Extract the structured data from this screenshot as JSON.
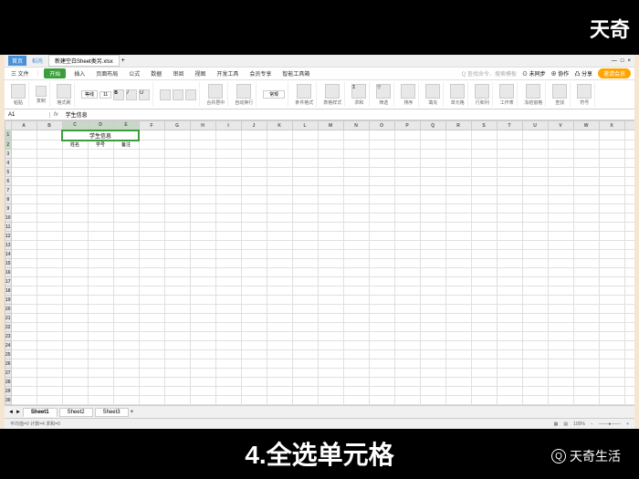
{
  "watermark_tr": "天奇",
  "watermark_br": "天奇生活",
  "watermark_q": "Q",
  "caption": "4.全选单元格",
  "titlebar": {
    "home": "首页",
    "browser_tab": "稻壳",
    "doc_tab": "新建空白Sheet类另.xlsx",
    "plus": "+",
    "min": "—",
    "max": "□",
    "close": "×"
  },
  "menu": {
    "file": "三 文件",
    "items": [
      "开始",
      "插入",
      "页面布局",
      "公式",
      "数据",
      "审阅",
      "视图",
      "开发工具",
      "会员专享",
      "智能工具箱"
    ],
    "search": "Q 查找命令、搜索模板",
    "unsync": "⊙ 未同步",
    "coop": "⊕ 协作",
    "share": "凸 分享",
    "member": "邀请会员"
  },
  "ribbon": {
    "paste": "粘贴",
    "cut": "剪切",
    "copy": "复制",
    "format_paint": "格式刷",
    "font": "等线",
    "font_size": "11",
    "merge": "合并居中",
    "wrap": "自动换行",
    "format": "常规",
    "conditional": "条件格式",
    "cell_style": "表格样式",
    "sum": "求和",
    "filter": "筛选",
    "sort": "排序",
    "fill": "填充",
    "cell": "单元格",
    "row_col": "行和列",
    "worksheet": "工作表",
    "freeze": "冻结窗格",
    "find": "查找",
    "symbol": "符号"
  },
  "name_box": "A1",
  "fx": "fx",
  "formula_value": "学生信息",
  "cols": [
    "A",
    "B",
    "C",
    "D",
    "E",
    "F",
    "G",
    "H",
    "I",
    "J",
    "K",
    "L",
    "M",
    "N",
    "O",
    "P",
    "Q",
    "R",
    "S",
    "T",
    "U",
    "V",
    "W",
    "X",
    "Y"
  ],
  "merged_title": "学生信息",
  "row2": {
    "c": "姓名",
    "d": "学号",
    "e": "备注"
  },
  "sheets": [
    "Sheet1",
    "Sheet2",
    "Sheet3"
  ],
  "sheet_plus": "+",
  "status": {
    "left": "平均值=0  计数=4  求和=0",
    "zoom": "100%"
  }
}
